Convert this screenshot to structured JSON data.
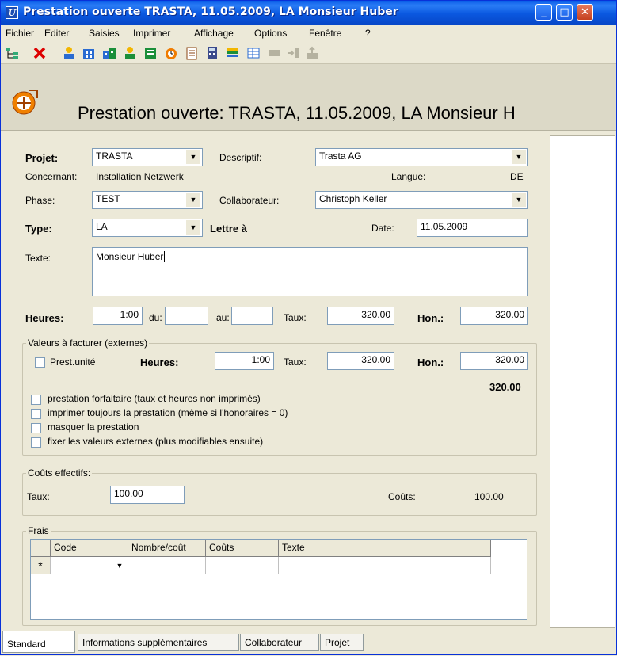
{
  "window": {
    "title": "Prestation ouverte TRASTA, 11.05.2009, LA Monsieur Huber",
    "minimize": "_",
    "maximize": "□",
    "close": "✕"
  },
  "menu": [
    "Fichier",
    "Editer",
    "Saisies",
    "Imprimer",
    "Affichage",
    "Options",
    "Fenêtre",
    "?"
  ],
  "toolbar_icons": [
    "tree-icon",
    "delete-icon",
    "person-icon",
    "building-icon",
    "buildings-icon",
    "person-green-icon",
    "notebook-icon",
    "clock-icon",
    "document-icon",
    "calculator-icon",
    "stack-icon",
    "table-icon",
    "block-icon",
    "arrow-right-icon",
    "export-icon"
  ],
  "header": {
    "title": "Prestation ouverte: TRASTA, 11.05.2009, LA Monsieur H"
  },
  "form": {
    "projet_label": "Projet:",
    "projet_value": "TRASTA",
    "descriptif_label": "Descriptif:",
    "descriptif_value": "Trasta AG",
    "concernant_label": "Concernant:",
    "concernant_value": "Installation Netzwerk",
    "langue_label": "Langue:",
    "langue_value": "DE",
    "phase_label": "Phase:",
    "phase_value": "TEST",
    "collab_label": "Collaborateur:",
    "collab_value": "Christoph Keller",
    "type_label": "Type:",
    "type_value": "LA",
    "lettre_label": "Lettre à",
    "date_label": "Date:",
    "date_value": "11.05.2009",
    "texte_label": "Texte:",
    "texte_value": "Monsieur Huber",
    "heures_label": "Heures:",
    "heures_value": "1:00",
    "du_label": "du:",
    "du_value": "",
    "au_label": "au:",
    "au_value": "",
    "taux_label": "Taux:",
    "taux_value": "320.00",
    "hon_label": "Hon.:",
    "hon_value": "320.00"
  },
  "valeurs": {
    "title": "Valeurs à facturer (externes)",
    "prest_unite": "Prest.unité",
    "heures_label": "Heures:",
    "heures_value": "1:00",
    "taux_label": "Taux:",
    "taux_value": "320.00",
    "hon_label": "Hon.:",
    "hon_value": "320.00",
    "total": "320.00",
    "options": [
      "prestation forfaitaire (taux et heures non imprimés)",
      "imprimer toujours la prestation (même si l'honoraires = 0)",
      "masquer la prestation",
      "fixer les valeurs externes (plus modifiables ensuite)"
    ]
  },
  "couts": {
    "title": "Coûts effectifs:",
    "taux_label": "Taux:",
    "taux_value": "100.00",
    "couts_label": "Coûts:",
    "couts_value": "100.00"
  },
  "frais": {
    "title": "Frais",
    "columns": [
      "Code",
      "Nombre/coût",
      "Coûts",
      "Texte"
    ],
    "new_row_marker": "*"
  },
  "tabs": [
    "Standard",
    "Informations supplémentaires",
    "Collaborateur",
    "Projet"
  ]
}
